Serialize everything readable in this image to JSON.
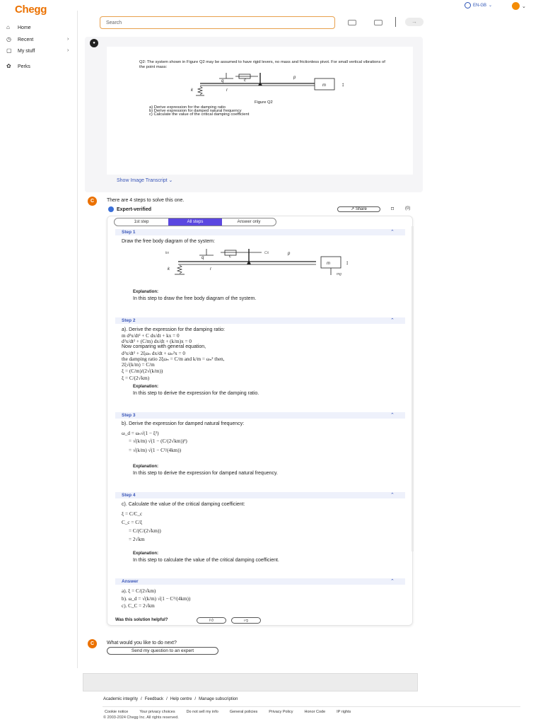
{
  "brand": {
    "logo": "Chegg",
    "accent": "#eb7100",
    "link": "#3a56b8"
  },
  "topbar": {
    "locale": "EN-GB",
    "search_placeholder": "Search"
  },
  "sidebar": {
    "items": [
      {
        "label": "Home",
        "icon": "home-icon"
      },
      {
        "label": "Recent",
        "icon": "clock-icon"
      },
      {
        "label": "My stuff",
        "icon": "bookmark-icon"
      },
      {
        "label": "Perks",
        "icon": "gift-icon"
      }
    ]
  },
  "question": {
    "text": "Q2: The system shown in Figure Q2 may be assumed to have rigid levers, no mass and frictionless pivot. For small vertical vibrations of the point mass:",
    "figure_caption": "Figure Q2",
    "parts": [
      "a)   Derive expression for the damping ratio",
      "b)   Derive expression for damped natural frequency",
      "c)   Calculate the value of the critical damping coefficient"
    ],
    "transcript_link": "Show Image Transcript"
  },
  "solution": {
    "intro": "There are 4 steps to solve this one.",
    "badge": "Expert-verified",
    "share": "Share",
    "bookmark_count": "(0)",
    "tabs": [
      "1st step",
      "All steps",
      "Answer only"
    ],
    "steps": [
      {
        "title": "Step 1",
        "text": "Draw the free body diagram of the system:",
        "expl_label": "Explanation:",
        "expl": "In this step to draw the free body diagram of the system."
      },
      {
        "title": "Step 2",
        "text": "a). Derive the expression for the damping ratio:",
        "math": [
          "m d²x/dt² + C dx/dt + kx = 0",
          "d²x/dt² + (C/m) dx/dt + (k/m)x = 0",
          "Now comparing with general equation,",
          "d²x/dt² + 2ξωₙ dx/dt + ωₙ²x = 0",
          "the damping ratio 2ξωₙ = C/m and k/m = ωₙ² then,",
          "2ξ√(k/m) = C/m",
          "ξ = (C/m)/(2√(k/m))",
          "ξ = C/(2√km)"
        ],
        "expl_label": "Explanation:",
        "expl": "In this step to derive the expression for the damping ratio."
      },
      {
        "title": "Step 3",
        "text": "b). Derive the expression for damped natural frequency:",
        "math": [
          "ω_d = ωₙ√(1 − ξ²)",
          "= √(k/m) √(1 − (C/(2√km))²)",
          "= √(k/m) √(1 − C²/(4km))"
        ],
        "expl_label": "Explanation:",
        "expl": "In this step to derive the expression for damped natural frequency."
      },
      {
        "title": "Step 4",
        "text": "c). Calculate the value of the critical damping coefficient:",
        "math": [
          "ξ = C/C_c",
          "C_c = C/ξ",
          "= C/(C/(2√km))",
          "= 2√km"
        ],
        "expl_label": "Explanation:",
        "expl": "In this step to calculate the value of the critical damping coefficient."
      }
    ],
    "answer": {
      "title": "Answer",
      "lines": [
        "a). ξ = C/(2√km)",
        "b). ω_d = √(k/m) √(1 − C²/(4km))",
        "c). C_C = 2√km"
      ]
    },
    "helpful": "Was this solution helpful?"
  },
  "next": {
    "title": "What would you like to do next?",
    "button": "Send my question to an expert"
  },
  "footer": {
    "links": [
      "Academic integrity",
      "Feedback",
      "Help centre",
      "Manage subscription"
    ],
    "legal": [
      "Cookie notice",
      "Your privacy choices",
      "Do not sell my info",
      "General policies",
      "Privacy Policy",
      "Honor Code",
      "IP rights"
    ],
    "copyright": "© 2003-2024 Chegg Inc. All rights reserved."
  }
}
